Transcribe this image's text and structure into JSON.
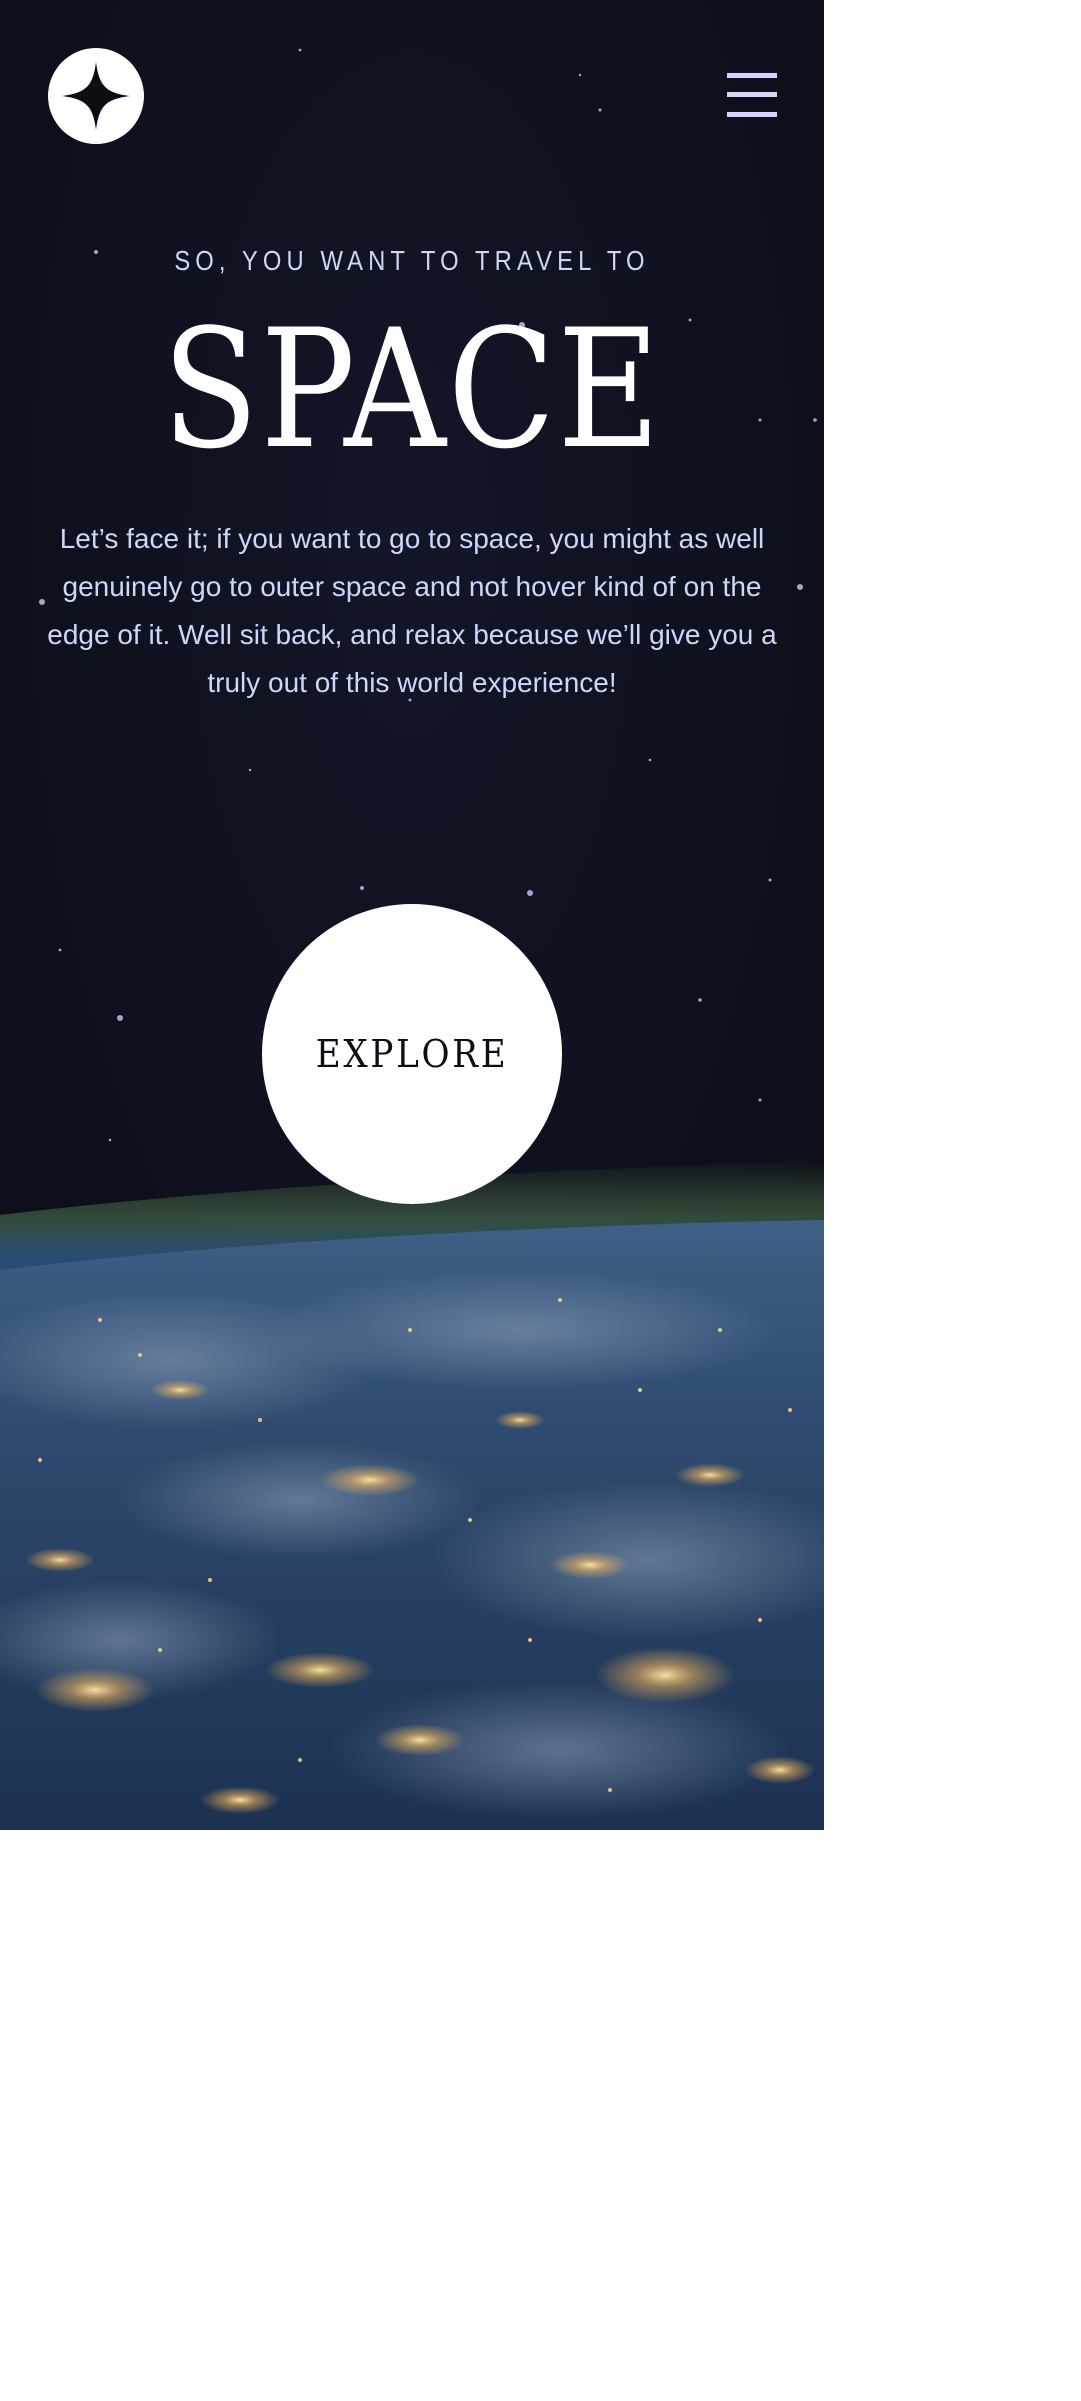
{
  "page": {
    "background_color": "#0b0d17",
    "accent_color": "#d0d6f9",
    "text_color": "#ffffff"
  },
  "header": {
    "logo_icon": "four-point-star-icon",
    "menu_icon": "hamburger-menu-icon"
  },
  "hero": {
    "eyebrow": "SO, YOU WANT TO TRAVEL TO",
    "title": "SPACE",
    "description": "Let’s face it; if you want to go to space, you might as well genuinely go to outer space and not hover kind of on the edge of it. Well sit back, and relax because we’ll give you a truly out of this world experience!"
  },
  "cta": {
    "label": "EXPLORE"
  }
}
